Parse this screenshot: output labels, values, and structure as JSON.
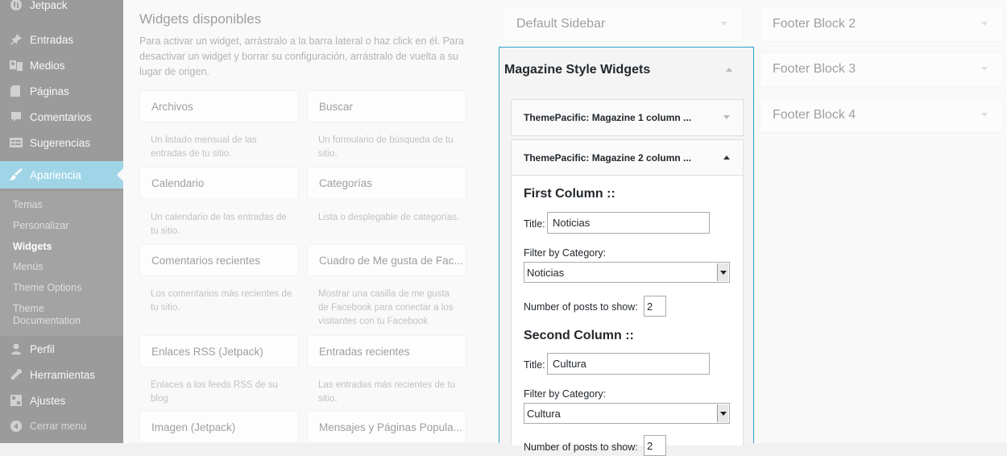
{
  "admin_menu": {
    "items": [
      {
        "label": "Jetpack",
        "icon": "jetpack-icon"
      },
      {
        "label": "Entradas",
        "icon": "pin-icon"
      },
      {
        "label": "Medios",
        "icon": "media-icon"
      },
      {
        "label": "Páginas",
        "icon": "page-icon"
      },
      {
        "label": "Comentarios",
        "icon": "comment-icon"
      },
      {
        "label": "Sugerencias",
        "icon": "feedback-icon"
      },
      {
        "label": "Apariencia",
        "icon": "brush-icon"
      },
      {
        "label": "Perfil",
        "icon": "user-icon"
      },
      {
        "label": "Herramientas",
        "icon": "wrench-icon"
      },
      {
        "label": "Ajustes",
        "icon": "settings-icon"
      }
    ],
    "submenu": [
      {
        "label": "Temas"
      },
      {
        "label": "Personalizar"
      },
      {
        "label": "Widgets"
      },
      {
        "label": "Menús"
      },
      {
        "label": "Theme Options"
      },
      {
        "label": "Theme Documentation"
      }
    ],
    "collapse_label": "Cerrar menú",
    "active_color": "#2ea2cc"
  },
  "available_widgets": {
    "title": "Widgets disponibles",
    "description": "Para activar un widget, arrástralo a la barra lateral o haz click en él. Para desactivar un widget y borrar su configuración, arrástralo de vuelta a su lugar de origen.",
    "widgets": [
      {
        "name": "Archivos",
        "desc": "Un listado mensual de las entradas de tu sitio."
      },
      {
        "name": "Buscar",
        "desc": "Un formulario de búsqueda de tu sitio."
      },
      {
        "name": "Calendario",
        "desc": "Un calendario de las entradas de tu sitio."
      },
      {
        "name": "Categorías",
        "desc": "Lista o desplegable de categorías."
      },
      {
        "name": "Comentarios recientes",
        "desc": "Los comentarios más recientes de tu sitio."
      },
      {
        "name": "Cuadro de Me gusta de Fac...",
        "desc": "Mostrar una casilla de me gusta de Facebook para conectar a los visitantes con tu Facebook"
      },
      {
        "name": "Enlaces RSS (Jetpack)",
        "desc": "Enlaces a los feeds RSS de su blog"
      },
      {
        "name": "Entradas recientes",
        "desc": "Las entradas más recientes de tu sitio."
      },
      {
        "name": "Imagen (Jetpack)",
        "desc": ""
      },
      {
        "name": "Mensajes y Páginas Popula...",
        "desc": ""
      }
    ]
  },
  "sidebars": {
    "default": {
      "title": "Default Sidebar"
    },
    "magazine": {
      "title": "Magazine Style Widgets",
      "widgets": [
        {
          "title": "ThemePacific: Magazine 1 column ..."
        },
        {
          "title": "ThemePacific: Magazine 2 column ..."
        }
      ],
      "form": {
        "first_column_heading": "First Column ::",
        "title_label": "Title:",
        "first_title_value": "Noticias",
        "filter_label": "Filter by Category:",
        "first_category": "Noticias",
        "posts_label": "Number of posts to show:",
        "first_posts": "2",
        "second_column_heading": "Second Column ::",
        "second_title_value": "Cultura",
        "second_category": "Cultura",
        "second_posts": "2"
      }
    },
    "footer_blocks": [
      {
        "title": "Footer Block 2"
      },
      {
        "title": "Footer Block 3"
      },
      {
        "title": "Footer Block 4"
      }
    ]
  }
}
